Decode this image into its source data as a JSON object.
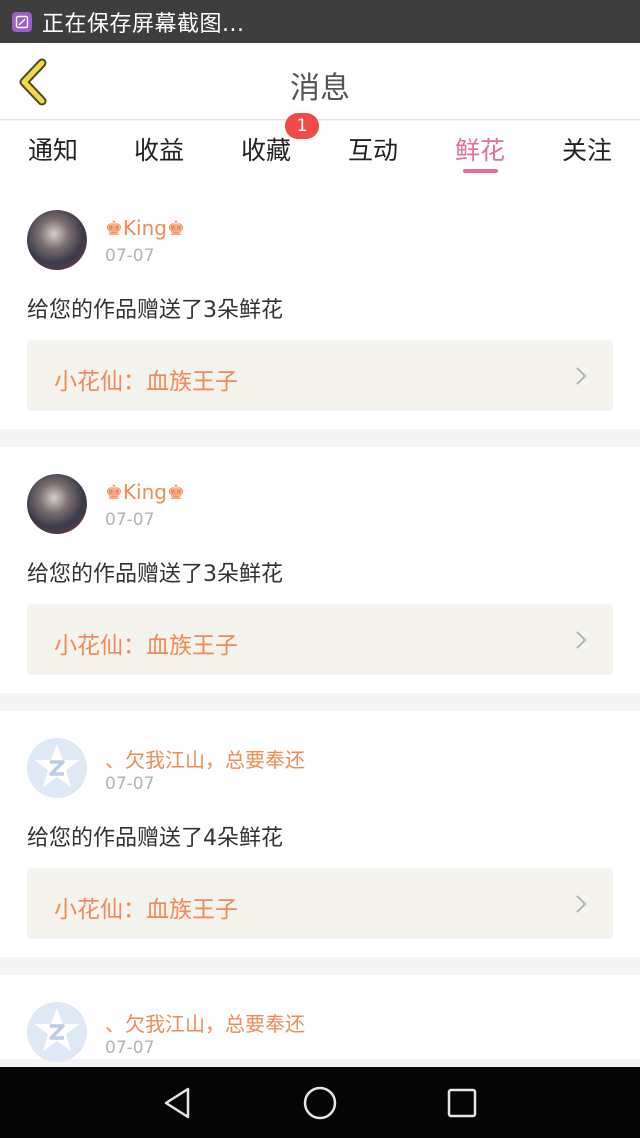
{
  "status_bar": {
    "text": "正在保存屏幕截图...",
    "icon": "screenshot-icon"
  },
  "header": {
    "title": "消息",
    "back_icon": "chevron-left-icon"
  },
  "tabs": [
    {
      "label": "通知"
    },
    {
      "label": "收益"
    },
    {
      "label": "收藏",
      "badge": "1"
    },
    {
      "label": "互动"
    },
    {
      "label": "鲜花",
      "active": true
    },
    {
      "label": "关注"
    }
  ],
  "feed": [
    {
      "username": "♚King♚",
      "date": "07-07",
      "avatar": "photo-avatar",
      "message": "给您的作品赠送了3朵鲜花",
      "work": "小花仙：血族王子"
    },
    {
      "username": "♚King♚",
      "date": "07-07",
      "avatar": "photo-avatar",
      "message": "给您的作品赠送了3朵鲜花",
      "work": "小花仙：血族王子"
    },
    {
      "username": "、欠我江山，总要奉还",
      "date": "07-07",
      "avatar": "qq-default-avatar",
      "message": "给您的作品赠送了4朵鲜花",
      "work": "小花仙：血族王子"
    },
    {
      "username": "、欠我江山，总要奉还",
      "date": "07-07",
      "avatar": "qq-default-avatar"
    }
  ],
  "nav_bar": {
    "back": "triangle-back-icon",
    "home": "circle-home-icon",
    "recents": "square-recents-icon"
  },
  "colors": {
    "accent": "#e3709c",
    "username": "#ef8b56",
    "badge": "#f04a4a",
    "link_bg": "#f5f3ee"
  }
}
